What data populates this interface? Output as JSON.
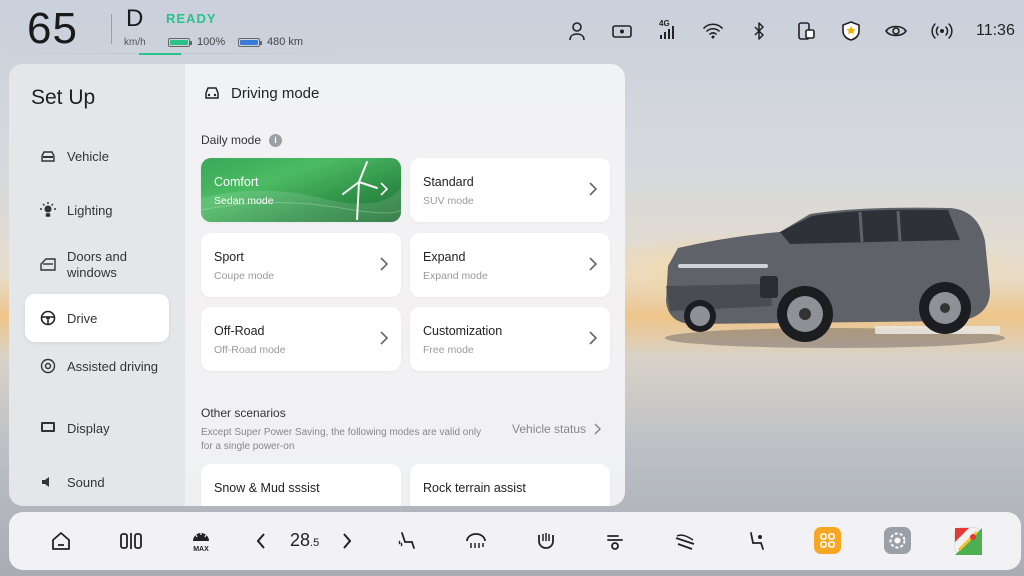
{
  "status": {
    "speed": "65",
    "speed_unit": "km/h",
    "gear": "D",
    "ready": "READY",
    "battery_pct": "100%",
    "range": "480 km",
    "time": "11:36",
    "network": "4G",
    "icons": [
      "user-icon",
      "dashcam-icon",
      "signal-4g-icon",
      "wifi-icon",
      "bluetooth-icon",
      "phone-mirror-icon",
      "shield-icon",
      "eye-icon",
      "radio-icon"
    ]
  },
  "sidebar": {
    "title": "Set Up",
    "items": [
      {
        "label": "Vehicle",
        "icon": "car-icon"
      },
      {
        "label": "Lighting",
        "icon": "light-icon"
      },
      {
        "label": "Doors and windows",
        "icon": "door-icon"
      },
      {
        "label": "Drive",
        "icon": "steering-wheel-icon",
        "active": true
      },
      {
        "label": "Assisted driving",
        "icon": "assisted-driving-icon"
      },
      {
        "label": "Display",
        "icon": "display-icon"
      },
      {
        "label": "Sound",
        "icon": "speaker-icon"
      }
    ]
  },
  "content": {
    "title": "Driving mode",
    "daily_label": "Daily mode",
    "modes": [
      {
        "title": "Comfort",
        "sub": "Sedan mode",
        "selected": true
      },
      {
        "title": "Standard",
        "sub": "SUV mode"
      },
      {
        "title": "Sport",
        "sub": "Coupe mode"
      },
      {
        "title": "Expand",
        "sub": "Expand mode"
      },
      {
        "title": "Off-Road",
        "sub": "Off-Road mode"
      },
      {
        "title": "Customization",
        "sub": "Free mode"
      }
    ],
    "other_label": "Other scenarios",
    "other_desc": "Except Super Power Saving, the following modes are valid only for a single power-on",
    "vehicle_status": "Vehicle status",
    "scenarios": [
      {
        "title": "Snow & Mud sssist"
      },
      {
        "title": "Rock terrain assist"
      }
    ]
  },
  "dock": {
    "temp_main": "28",
    "temp_dec": ".5",
    "icons": [
      "home-icon",
      "split-screen-icon",
      "max-defrost-icon",
      "temp-down-icon",
      "temp-up-icon",
      "seat-heat-icon",
      "steering-heat-icon",
      "seat-vent-icon",
      "airflow-icon",
      "seat-massage-icon",
      "seat-adjust-icon",
      "apps-icon",
      "settings-icon",
      "maps-icon"
    ]
  },
  "colors": {
    "accent": "#2bc28a",
    "apps_tile": "#f5a623",
    "selected_card": "#3aa85a"
  }
}
